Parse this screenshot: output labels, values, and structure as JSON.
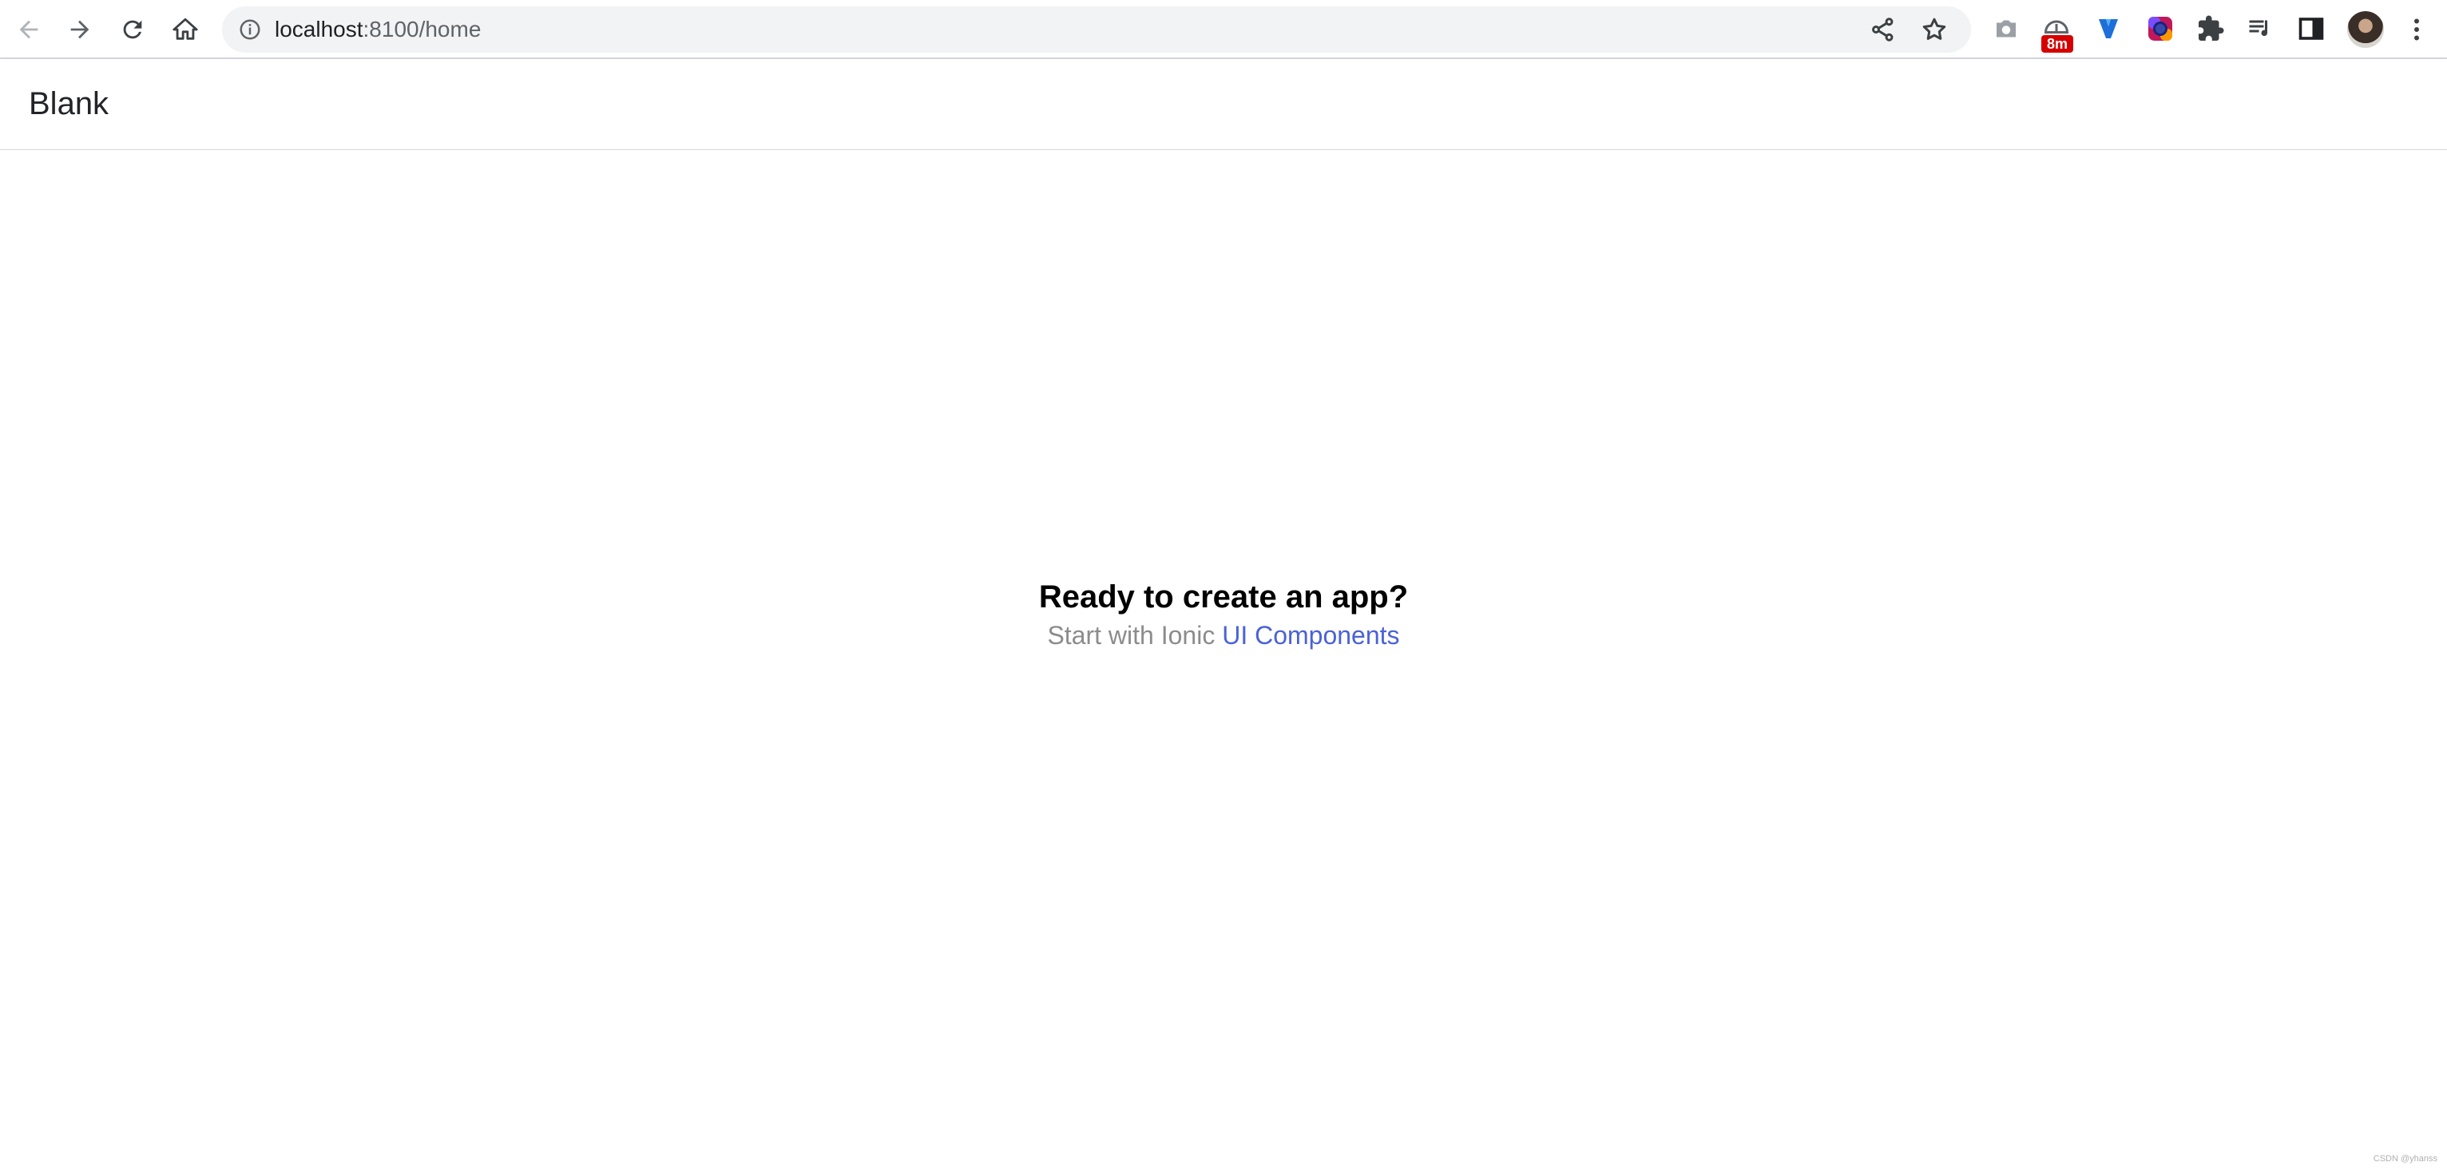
{
  "browser": {
    "url_host": "localhost",
    "url_path": ":8100/home",
    "extension_badge": "8m"
  },
  "header": {
    "title": "Blank"
  },
  "content": {
    "title": "Ready to create an app?",
    "subtitle_prefix": "Start with Ionic ",
    "link_label": "UI Components"
  },
  "watermark": "CSDN @yhanss",
  "icons": {
    "back": "arrow-left-icon",
    "forward": "arrow-right-icon",
    "reload": "reload-icon",
    "home": "home-icon",
    "info": "info-icon",
    "share": "share-icon",
    "bookmark": "star-icon",
    "camera": "camera-icon",
    "timer": "timer-extension-icon",
    "v_ext": "v-extension-icon",
    "color": "color-picker-icon",
    "extensions": "puzzle-icon",
    "media": "media-control-icon",
    "side_panel": "side-panel-icon",
    "menu": "more-vert-icon"
  },
  "colors": {
    "link": "#4a62d8",
    "subtitle": "#8c8c8c",
    "badge": "#d60000"
  }
}
